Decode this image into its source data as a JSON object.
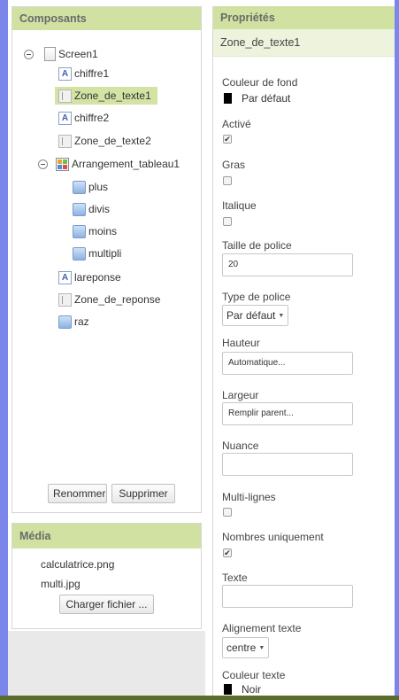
{
  "components": {
    "header": "Composants",
    "tree": [
      {
        "name": "Screen1",
        "icon": "screen-icon",
        "selected": false
      },
      {
        "name": "chiffre1",
        "icon": "label-icon",
        "selected": false
      },
      {
        "name": "Zone_de_texte1",
        "icon": "textbox-icon",
        "selected": true
      },
      {
        "name": "chiffre2",
        "icon": "label-icon",
        "selected": false
      },
      {
        "name": "Zone_de_texte2",
        "icon": "textbox-icon",
        "selected": false
      },
      {
        "name": "Arrangement_tableau1",
        "icon": "table-arrangement-icon",
        "selected": false
      },
      {
        "name": "plus",
        "icon": "button-icon",
        "selected": false
      },
      {
        "name": "divis",
        "icon": "button-icon",
        "selected": false
      },
      {
        "name": "moins",
        "icon": "button-icon",
        "selected": false
      },
      {
        "name": "multipli",
        "icon": "button-icon",
        "selected": false
      },
      {
        "name": "lareponse",
        "icon": "label-icon",
        "selected": false
      },
      {
        "name": "Zone_de_reponse",
        "icon": "textbox-icon",
        "selected": false
      },
      {
        "name": "raz",
        "icon": "button-icon",
        "selected": false
      }
    ],
    "rename_label": "Renommer",
    "delete_label": "Supprimer"
  },
  "media": {
    "header": "Média",
    "files": [
      "calculatrice.png",
      "multi.jpg"
    ],
    "upload_label": "Charger fichier ..."
  },
  "properties": {
    "header": "Propriétés",
    "selected_component": "Zone_de_texte1",
    "background_color": {
      "label": "Couleur de fond",
      "value": "Par défaut",
      "color": "#000000"
    },
    "enabled": {
      "label": "Activé",
      "checked": true
    },
    "bold": {
      "label": "Gras",
      "checked": false
    },
    "italic": {
      "label": "Italique",
      "checked": false
    },
    "font_size": {
      "label": "Taille de police",
      "value": "20"
    },
    "font_type": {
      "label": "Type de police",
      "value": "Par défaut"
    },
    "height": {
      "label": "Hauteur",
      "value": "Automatique..."
    },
    "width": {
      "label": "Largeur",
      "value": "Remplir parent..."
    },
    "hint": {
      "label": "Nuance",
      "value": ""
    },
    "multiline": {
      "label": "Multi-lignes",
      "checked": false
    },
    "numbers_only": {
      "label": "Nombres uniquement",
      "checked": true
    },
    "text": {
      "label": "Texte",
      "value": ""
    },
    "text_alignment": {
      "label": "Alignement texte",
      "value": "centre"
    },
    "text_color": {
      "label": "Couleur texte",
      "value": "Noir",
      "color": "#000000"
    }
  },
  "colors": {
    "header_green": "#d0e1a1",
    "selected_green": "#d3e3a4",
    "frame_blue": "#7b86ea"
  }
}
